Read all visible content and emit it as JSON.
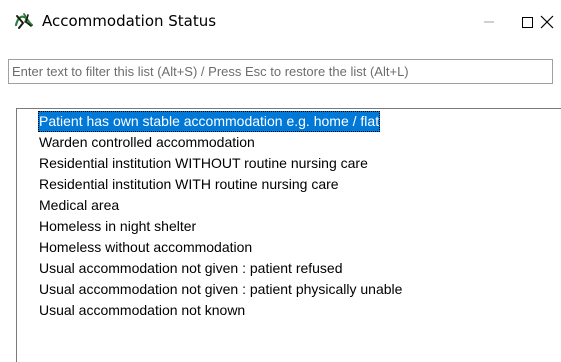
{
  "window": {
    "title": "Accommodation Status",
    "icon": "spider-app-icon",
    "controls": {
      "minimize": "minimize",
      "maximize": "maximize",
      "close": "close"
    }
  },
  "filter": {
    "placeholder": "Enter text to filter this list (Alt+S) / Press Esc to restore the list (Alt+L)",
    "value": ""
  },
  "list": {
    "selected_index": 0,
    "items": [
      "Patient has own stable accommodation e.g. home / flat",
      "Warden controlled accommodation",
      "Residential institution WITHOUT routine nursing care",
      "Residential institution WITH routine nursing care",
      "Medical area",
      "Homeless in night shelter",
      "Homeless without accommodation",
      "Usual accommodation not given : patient refused",
      "Usual accommodation not given : patient physically unable",
      "Usual accommodation not known"
    ]
  },
  "colors": {
    "selection": "#0078d7",
    "icon_green": "#2e7d32",
    "icon_dark": "#1a1a1a"
  }
}
